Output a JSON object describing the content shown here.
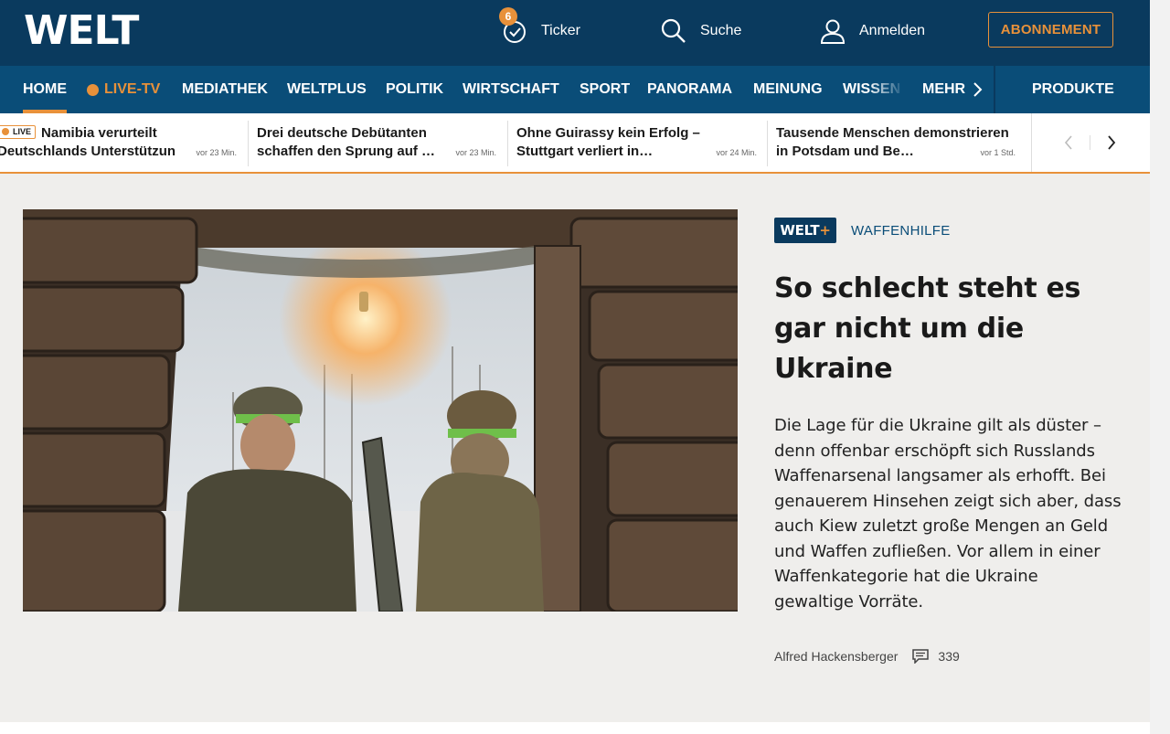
{
  "header": {
    "logo": "WELT",
    "ticker_label": "Ticker",
    "ticker_count": "6",
    "search_label": "Suche",
    "login_label": "Anmelden",
    "subscribe_label": "ABONNEMENT"
  },
  "nav": {
    "items": [
      {
        "label": "HOME"
      },
      {
        "label": "LIVE-TV"
      },
      {
        "label": "MEDIATHEK"
      },
      {
        "label": "WELTPLUS"
      },
      {
        "label": "POLITIK"
      },
      {
        "label": "WIRTSCHAFT"
      },
      {
        "label": "SPORT"
      },
      {
        "label": "PANORAMA"
      },
      {
        "label": "MEINUNG"
      },
      {
        "label": "WISSEN"
      },
      {
        "label": "MEHR"
      }
    ],
    "products_label": "PRODUKTE"
  },
  "news_ticker": {
    "live_label": "LIVE",
    "items": [
      {
        "line1": "Namibia verurteilt",
        "line2": "Deutschlands Unterstützun",
        "time": "vor 23 Min."
      },
      {
        "line1": "Drei deutsche Debütanten",
        "line2": "schaffen den Sprung auf …",
        "time": "vor 23 Min."
      },
      {
        "line1": "Ohne Guirassy kein Erfolg –",
        "line2": "Stuttgart verliert in…",
        "time": "vor 24 Min."
      },
      {
        "line1": "Tausende Menschen demonstrieren",
        "line2": "in Potsdam und Be…",
        "time": "vor 1 Std."
      }
    ]
  },
  "teaser": {
    "badge": "WELT",
    "badge_plus": "+",
    "kicker": "WAFFENHILFE",
    "headline": "So schlecht steht es gar nicht um die Ukraine",
    "lead": "Die Lage für die Ukraine gilt als düster – denn offenbar erschöpft sich Russlands Waffenarsenal langsamer als erhofft. Bei genauerem Hinsehen zeigt sich aber, dass auch Kiew zuletzt große Mengen an Geld und Waffen zufließen. Vor allem in einer Waffenkategorie hat die Ukraine gewaltige Vorräte.",
    "author": "Alfred Hackensberger",
    "comments": "339"
  },
  "colors": {
    "brand_dark": "#0a3a5e",
    "brand_nav": "#0a4d78",
    "accent": "#e8913a",
    "background": "#efeeec"
  }
}
